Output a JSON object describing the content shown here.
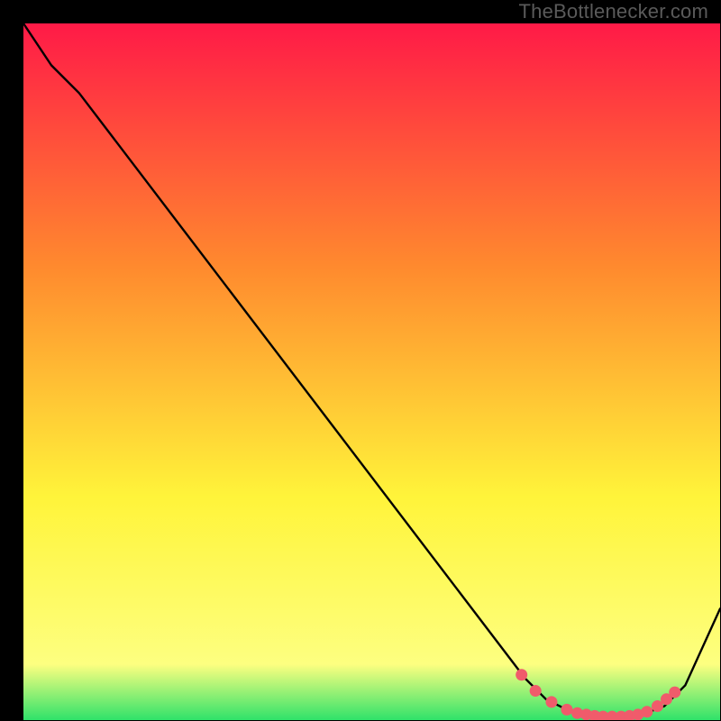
{
  "watermark": "TheBottlenecker.com",
  "colors": {
    "grad_top": "#ff1a47",
    "grad_mid1": "#ff8a2e",
    "grad_mid2": "#fff43a",
    "grad_low": "#fdff80",
    "grad_green": "#2fe26a",
    "curve": "#000000",
    "dot_fill": "#f05b6b",
    "dot_stroke": "#e9606f"
  },
  "chart_data": {
    "type": "line",
    "title": "",
    "xlabel": "",
    "ylabel": "",
    "xlim": [
      0,
      100
    ],
    "ylim": [
      0,
      100
    ],
    "curve": {
      "x": [
        0,
        4,
        8,
        72,
        75,
        78,
        83,
        88,
        92,
        95,
        100
      ],
      "y": [
        100,
        94,
        90,
        6,
        3,
        1.5,
        0.5,
        0.5,
        2,
        5,
        16
      ]
    },
    "markers": {
      "x": [
        71.5,
        73.5,
        75.8,
        78,
        79.5,
        80.8,
        82,
        83.2,
        84.5,
        85.8,
        87,
        88.2,
        89.5,
        91,
        92.3,
        93.5
      ],
      "y": [
        6.5,
        4.2,
        2.6,
        1.5,
        1.0,
        0.8,
        0.6,
        0.5,
        0.5,
        0.5,
        0.6,
        0.8,
        1.2,
        2.0,
        3.0,
        4.0
      ]
    }
  }
}
